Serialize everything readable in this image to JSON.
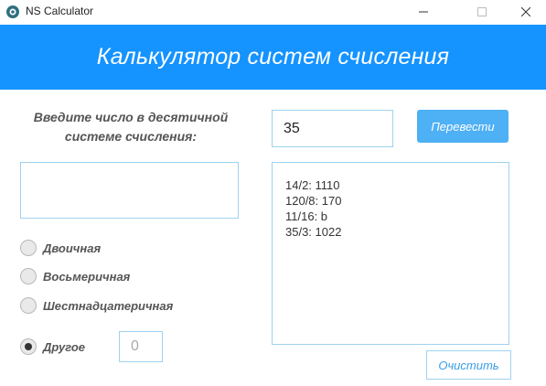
{
  "window": {
    "title": "NS Calculator",
    "icon": "app-logo-icon"
  },
  "header": {
    "title": "Калькулятор систем счисления",
    "background": "#1593ff"
  },
  "form": {
    "prompt_line1": "Введите число в десятичной",
    "prompt_line2": "системе счисления:",
    "number_value": "35",
    "convert_label": "Перевести",
    "result_value": "",
    "other_base_value": "0",
    "clear_label": "Очистить"
  },
  "radios": [
    {
      "label": "Двоичная",
      "checked": false
    },
    {
      "label": "Восьмеричная",
      "checked": false
    },
    {
      "label": "Шестнадцатеричная",
      "checked": false
    },
    {
      "label": "Другое",
      "checked": true
    }
  ],
  "history": [
    "14/2: 1110",
    "120/8: 170",
    "11/16: b",
    "35/3: 1022"
  ],
  "colors": {
    "accent": "#1593ff",
    "button": "#4eb0f5",
    "border": "#9fd2f0"
  }
}
